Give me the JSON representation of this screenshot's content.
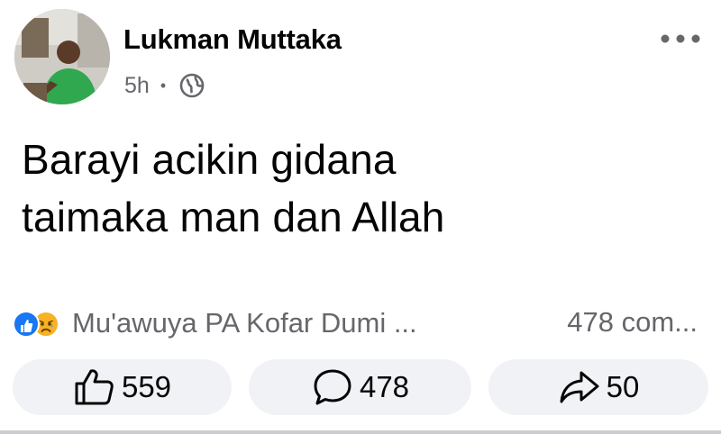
{
  "post": {
    "author": "Lukman Muttaka",
    "time": "5h",
    "separator": "•",
    "privacy_icon": "globe-icon",
    "menu_icon": "more-options-icon",
    "text_lines": [
      "Barayi acikin gidana",
      "taimaka man dan Allah"
    ]
  },
  "reactions": {
    "icons": [
      "like-reaction-icon",
      "sad-reaction-icon"
    ],
    "reactors_text": "Mu'awuya PA Kofar Dumi ...",
    "comments_text": "478 com..."
  },
  "actions": {
    "like_count": "559",
    "comment_count": "478",
    "share_count": "50"
  },
  "colors": {
    "brand_blue": "#1877f2",
    "sad_yellow": "#f7b125",
    "secondary_text": "#65676b",
    "button_bg": "#f0f2f5"
  }
}
